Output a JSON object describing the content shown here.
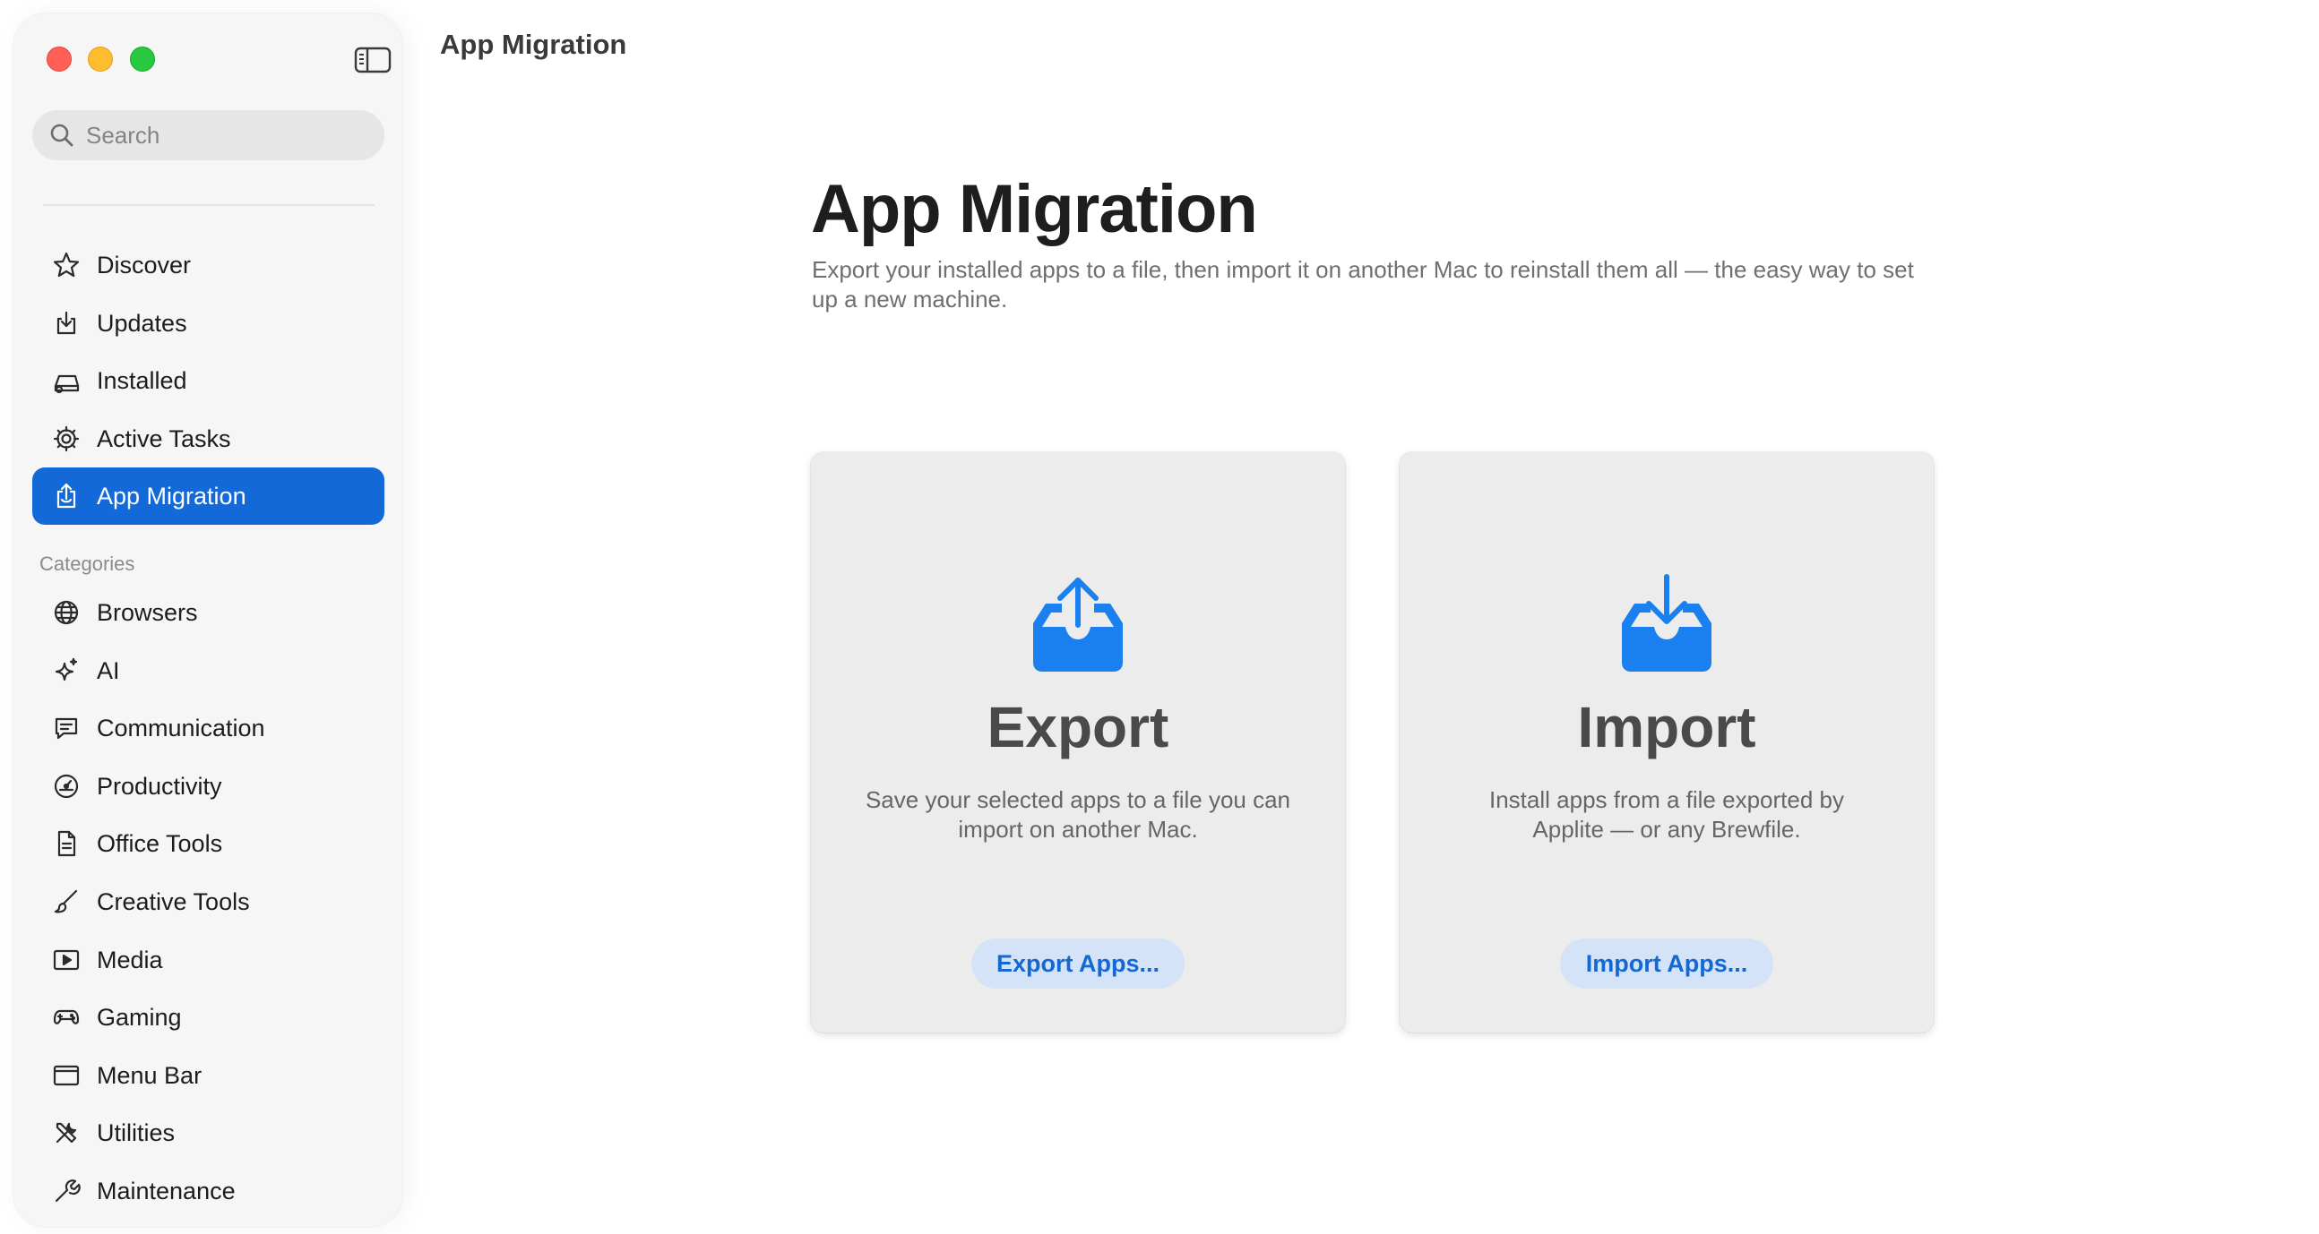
{
  "window": {
    "title": "App Migration"
  },
  "search": {
    "placeholder": "Search"
  },
  "sidebar": {
    "nav": [
      {
        "label": "Discover",
        "icon": "star-icon"
      },
      {
        "label": "Updates",
        "icon": "download-icon"
      },
      {
        "label": "Installed",
        "icon": "installed-icon"
      },
      {
        "label": "Active Tasks",
        "icon": "gear-icon"
      },
      {
        "label": "App Migration",
        "icon": "migration-icon",
        "active": true
      }
    ],
    "categories_heading": "Categories",
    "categories": [
      {
        "label": "Browsers",
        "icon": "globe-icon"
      },
      {
        "label": "AI",
        "icon": "sparkles-icon"
      },
      {
        "label": "Communication",
        "icon": "chat-bubble-icon"
      },
      {
        "label": "Productivity",
        "icon": "gauge-icon"
      },
      {
        "label": "Office Tools",
        "icon": "document-icon"
      },
      {
        "label": "Creative Tools",
        "icon": "paintbrush-icon"
      },
      {
        "label": "Media",
        "icon": "play-icon"
      },
      {
        "label": "Gaming",
        "icon": "gamepad-icon"
      },
      {
        "label": "Menu Bar",
        "icon": "menubar-icon"
      },
      {
        "label": "Utilities",
        "icon": "tools-icon"
      },
      {
        "label": "Maintenance",
        "icon": "wrench-icon"
      }
    ]
  },
  "main": {
    "title": "App Migration",
    "subtitle": "Export your installed apps to a file, then import it on another Mac to reinstall them all — the easy way to set up a new machine.",
    "cards": [
      {
        "title": "Export",
        "description": "Save your selected apps to a file you can import on another Mac.",
        "button": "Export Apps..."
      },
      {
        "title": "Import",
        "description": "Install apps from a file exported by Applite — or any Brewfile.",
        "button": "Import Apps..."
      }
    ]
  },
  "colors": {
    "accent": "#1469d8",
    "icon_blue": "#1a80f0",
    "button_bg": "#d4e3f7",
    "sidebar_bg": "#f6f6f6",
    "card_bg": "#ececec"
  }
}
